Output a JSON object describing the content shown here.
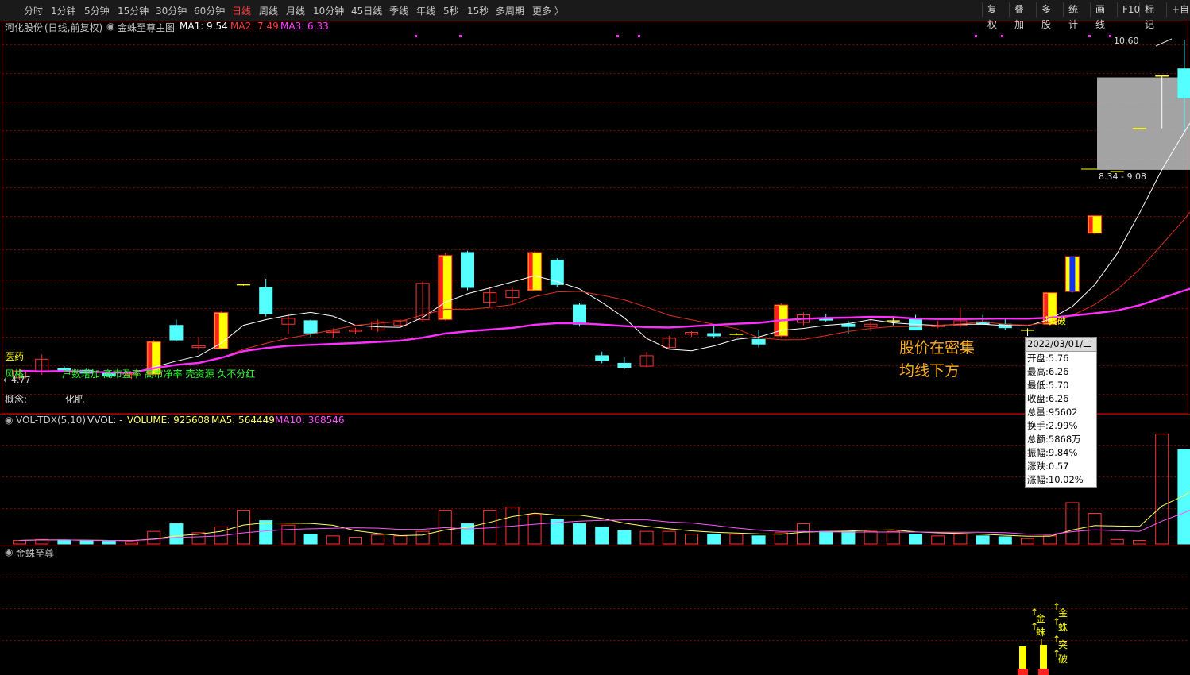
{
  "toolbar": {
    "periods": [
      "分时",
      "1分钟",
      "5分钟",
      "15分钟",
      "30分钟",
      "60分钟",
      "日线",
      "周线",
      "月线",
      "10分钟",
      "45日线",
      "季线",
      "年线",
      "5秒",
      "15秒",
      "多周期",
      "更多 〉"
    ],
    "active_period": "日线",
    "right_buttons": [
      "复权",
      "叠加",
      "多股",
      "统计",
      "画线",
      "F10",
      "标记",
      "+自"
    ]
  },
  "main_panel": {
    "stock_name": "河化股份",
    "mode": "(日线,前复权)",
    "indicator": "金蛛至尊主图",
    "ma1": "MA1: 9.54",
    "ma2": "MA2: 7.49",
    "ma3": "MA3: 6.33",
    "high_label": "10.60",
    "low_label": "4.77",
    "zone_label": "8.34 - 9.08",
    "breakout_label": "突破",
    "note_line1": "股价在密集",
    "note_line2": "均线下方",
    "industry_label": "医药",
    "style_label": "风格:",
    "style_text": "户数增加 高市盈率 高市净率 壳资源 久不分红",
    "concept_label": "概念:",
    "concept_text": "化肥"
  },
  "vol_panel": {
    "name": "VOL-TDX(5,10)",
    "vvol": "VVOL: -",
    "volume": "VOLUME: 925608",
    "ma5": "MA5: 564449",
    "ma10": "MA10: 368546"
  },
  "sub_panel": {
    "name": "金蛛至尊",
    "sig1a": "金",
    "sig1b": "蛛",
    "sig2a": "金",
    "sig2b": "蛛",
    "sig2c": "突",
    "sig2d": "破"
  },
  "tooltip": {
    "date": "2022/03/01/二",
    "open": "开盘:5.76",
    "high": "最高:6.26",
    "low": "最低:5.70",
    "close": "收盘:6.26",
    "volume": "总量:95602",
    "turnover": "换手:2.99%",
    "amount": "总额:5868万",
    "amplitude": "振幅:9.84%",
    "change": "涨跌:0.57",
    "change_pct": "涨幅:10.02%"
  },
  "colors": {
    "up": "#ff3232",
    "down": "#54ffff",
    "signal_yellow": "#ffff00",
    "signal_blue": "#1030ff",
    "ma1": "#ffffff",
    "ma2": "#e0301e",
    "ma3": "#ff30ff",
    "grid": "#7a0000",
    "vol_ma5": "#ffff66",
    "vol_ma10": "#ff55ff"
  },
  "chart_data": {
    "type": "candlestick",
    "price_axis": [
      4.77,
      10.6
    ],
    "candles": [
      {
        "o": 4.8,
        "h": 4.95,
        "l": 4.77,
        "c": 4.92,
        "k": "up"
      },
      {
        "o": 5.12,
        "h": 5.2,
        "l": 4.85,
        "c": 4.9,
        "k": "up"
      },
      {
        "o": 4.96,
        "h": 5.0,
        "l": 4.9,
        "c": 4.93,
        "k": "down"
      },
      {
        "o": 4.93,
        "h": 4.97,
        "l": 4.82,
        "c": 4.88,
        "k": "down"
      },
      {
        "o": 4.88,
        "h": 4.92,
        "l": 4.8,
        "c": 4.83,
        "k": "down"
      },
      {
        "o": 4.83,
        "h": 4.9,
        "l": 4.78,
        "c": 4.86,
        "k": "up"
      },
      {
        "o": 4.86,
        "h": 5.45,
        "l": 4.84,
        "c": 5.42,
        "k": "sig"
      },
      {
        "o": 5.7,
        "h": 5.8,
        "l": 5.42,
        "c": 5.45,
        "k": "down"
      },
      {
        "o": 5.35,
        "h": 5.5,
        "l": 5.28,
        "c": 5.32,
        "k": "up"
      },
      {
        "o": 5.3,
        "h": 5.95,
        "l": 5.28,
        "c": 5.92,
        "k": "sig"
      },
      {
        "o": 6.4,
        "h": 6.4,
        "l": 6.38,
        "c": 6.4,
        "k": "flat"
      },
      {
        "o": 6.35,
        "h": 6.5,
        "l": 5.85,
        "c": 5.9,
        "k": "down"
      },
      {
        "o": 5.72,
        "h": 5.9,
        "l": 5.55,
        "c": 5.82,
        "k": "up"
      },
      {
        "o": 5.78,
        "h": 5.8,
        "l": 5.5,
        "c": 5.57,
        "k": "down"
      },
      {
        "o": 5.58,
        "h": 5.65,
        "l": 5.49,
        "c": 5.6,
        "k": "up"
      },
      {
        "o": 5.6,
        "h": 5.66,
        "l": 5.55,
        "c": 5.62,
        "k": "up"
      },
      {
        "o": 5.62,
        "h": 5.8,
        "l": 5.59,
        "c": 5.76,
        "k": "up"
      },
      {
        "o": 5.7,
        "h": 5.8,
        "l": 5.66,
        "c": 5.78,
        "k": "up"
      },
      {
        "o": 5.8,
        "h": 6.45,
        "l": 5.76,
        "c": 6.42,
        "k": "up"
      },
      {
        "o": 5.8,
        "h": 6.95,
        "l": 5.78,
        "c": 6.9,
        "k": "sig"
      },
      {
        "o": 6.95,
        "h": 6.98,
        "l": 6.3,
        "c": 6.35,
        "k": "down"
      },
      {
        "o": 6.1,
        "h": 6.35,
        "l": 6.0,
        "c": 6.26,
        "k": "up"
      },
      {
        "o": 6.18,
        "h": 6.35,
        "l": 6.06,
        "c": 6.3,
        "k": "up"
      },
      {
        "o": 6.3,
        "h": 6.98,
        "l": 6.28,
        "c": 6.95,
        "k": "sig"
      },
      {
        "o": 6.82,
        "h": 6.85,
        "l": 6.36,
        "c": 6.4,
        "k": "down"
      },
      {
        "o": 6.05,
        "h": 6.08,
        "l": 5.68,
        "c": 5.72,
        "k": "down"
      },
      {
        "o": 5.18,
        "h": 5.25,
        "l": 5.05,
        "c": 5.1,
        "k": "down"
      },
      {
        "o": 5.05,
        "h": 5.15,
        "l": 4.95,
        "c": 4.98,
        "k": "down"
      },
      {
        "o": 5.0,
        "h": 5.25,
        "l": 4.98,
        "c": 5.18,
        "k": "up"
      },
      {
        "o": 5.32,
        "h": 5.52,
        "l": 5.3,
        "c": 5.48,
        "k": "up"
      },
      {
        "o": 5.55,
        "h": 5.6,
        "l": 5.5,
        "c": 5.58,
        "k": "up"
      },
      {
        "o": 5.56,
        "h": 5.72,
        "l": 5.48,
        "c": 5.52,
        "k": "down"
      },
      {
        "o": 5.55,
        "h": 5.57,
        "l": 5.53,
        "c": 5.54,
        "k": "flat"
      },
      {
        "o": 5.46,
        "h": 5.62,
        "l": 5.32,
        "c": 5.38,
        "k": "down"
      },
      {
        "o": 5.52,
        "h": 6.08,
        "l": 5.5,
        "c": 6.05,
        "k": "sig"
      },
      {
        "o": 5.88,
        "h": 5.92,
        "l": 5.7,
        "c": 5.75,
        "k": "up"
      },
      {
        "o": 5.82,
        "h": 5.9,
        "l": 5.76,
        "c": 5.79,
        "k": "down"
      },
      {
        "o": 5.72,
        "h": 5.78,
        "l": 5.55,
        "c": 5.68,
        "k": "down"
      },
      {
        "o": 5.68,
        "h": 5.8,
        "l": 5.6,
        "c": 5.72,
        "k": "up"
      },
      {
        "o": 5.75,
        "h": 5.86,
        "l": 5.7,
        "c": 5.78,
        "k": "flat"
      },
      {
        "o": 5.8,
        "h": 5.88,
        "l": 5.7,
        "c": 5.62,
        "k": "down"
      },
      {
        "o": 5.68,
        "h": 5.78,
        "l": 5.65,
        "c": 5.7,
        "k": "up"
      },
      {
        "o": 5.7,
        "h": 6.0,
        "l": 5.66,
        "c": 5.78,
        "k": "up"
      },
      {
        "o": 5.76,
        "h": 5.88,
        "l": 5.74,
        "c": 5.72,
        "k": "down"
      },
      {
        "o": 5.72,
        "h": 5.8,
        "l": 5.62,
        "c": 5.66,
        "k": "down"
      },
      {
        "o": 5.62,
        "h": 5.65,
        "l": 5.52,
        "c": 5.6,
        "k": "flat"
      },
      {
        "o": 5.72,
        "h": 6.26,
        "l": 5.7,
        "c": 6.26,
        "k": "sig"
      },
      {
        "o": 6.28,
        "h": 6.88,
        "l": 6.26,
        "c": 6.88,
        "k": "sigblue"
      },
      {
        "o": 7.28,
        "h": 7.58,
        "l": 7.26,
        "c": 7.58,
        "k": "sig"
      },
      {
        "o": 8.34,
        "h": 8.34,
        "l": 8.34,
        "c": 8.34,
        "k": "flat"
      },
      {
        "o": 9.08,
        "h": 9.08,
        "l": 9.08,
        "c": 9.08,
        "k": "flat"
      },
      {
        "o": 9.98,
        "h": 9.98,
        "l": 9.08,
        "c": 9.98,
        "k": "flat"
      },
      {
        "o": 9.6,
        "h": 10.6,
        "l": 9.04,
        "c": 10.1,
        "k": "down"
      },
      {
        "o": 10.1,
        "h": 10.6,
        "l": 9.55,
        "c": 10.6,
        "k": "sig"
      }
    ],
    "volume": [
      8,
      10,
      9,
      7,
      6,
      5,
      28,
      45,
      25,
      38,
      75,
      52,
      42,
      22,
      18,
      15,
      20,
      18,
      28,
      75,
      45,
      75,
      82,
      65,
      55,
      45,
      38,
      30,
      28,
      28,
      22,
      22,
      22,
      18,
      25,
      45,
      28,
      28,
      28,
      28,
      22,
      18,
      22,
      18,
      16,
      12,
      18,
      92,
      68,
      10,
      8,
      245,
      210,
      235
    ]
  }
}
